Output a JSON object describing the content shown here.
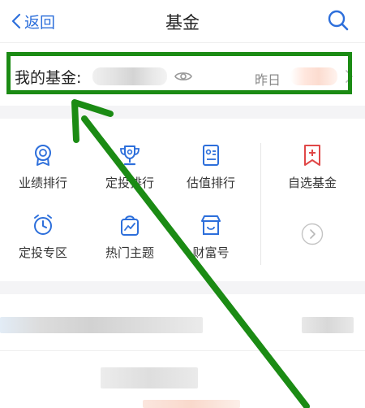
{
  "header": {
    "back_label": "返回",
    "title": "基金"
  },
  "my_fund": {
    "label": "我的基金:",
    "yesterday_label": "昨日"
  },
  "grid": {
    "items": [
      {
        "label": "业绩排行",
        "icon": "medal-icon"
      },
      {
        "label": "定投排行",
        "icon": "trophy-icon"
      },
      {
        "label": "估值排行",
        "icon": "certificate-icon"
      },
      {
        "label": "自选基金",
        "icon": "bookmark-plus-icon"
      },
      {
        "label": "定投专区",
        "icon": "alarm-clock-icon"
      },
      {
        "label": "热门主题",
        "icon": "chart-bag-icon"
      },
      {
        "label": "财富号",
        "icon": "store-icon"
      }
    ]
  },
  "colors": {
    "accent_blue": "#2d6fdb",
    "highlight_green": "#1b8b14",
    "bookmark_red": "#e04848"
  }
}
